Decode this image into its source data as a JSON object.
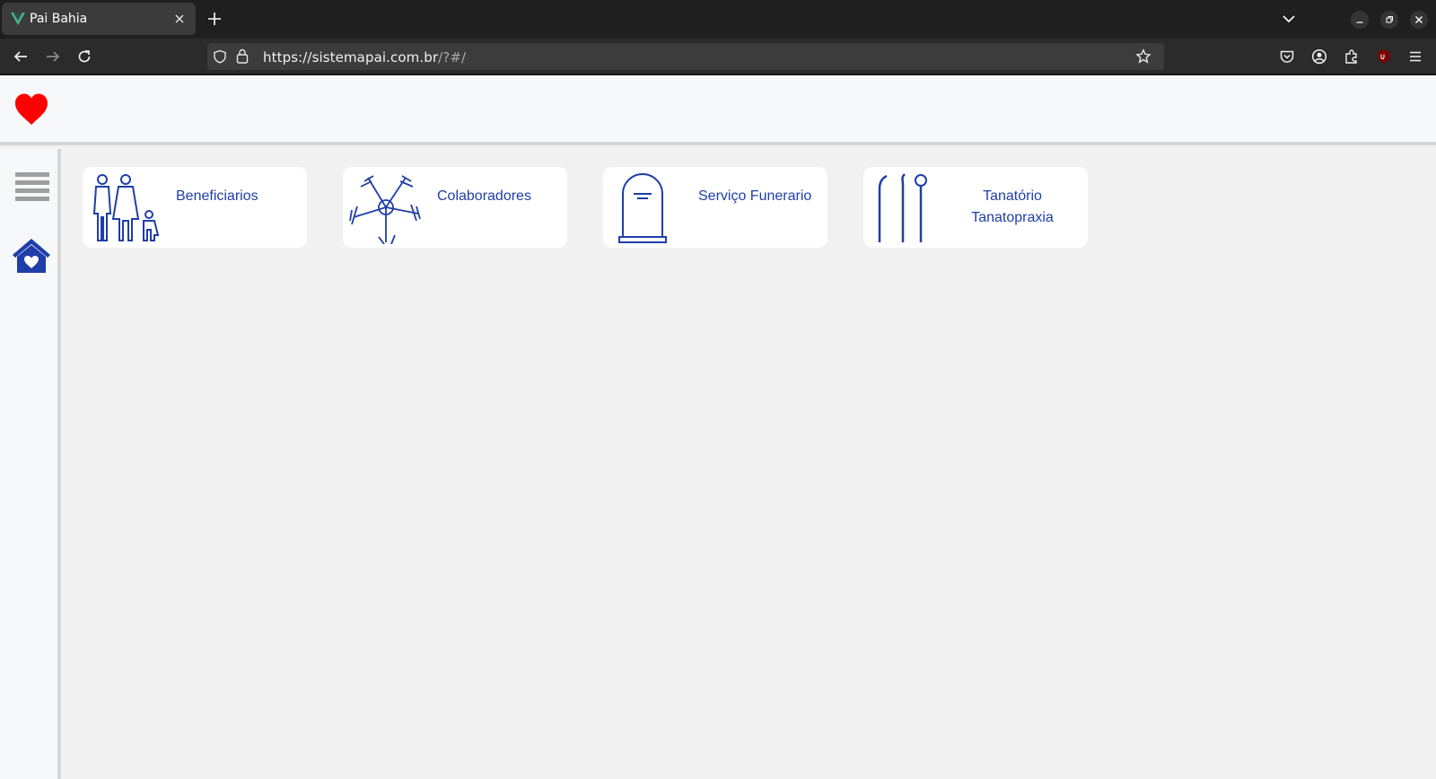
{
  "browser": {
    "tab_title": "Pai Bahia",
    "url_host": "https://sistemapai.com.br",
    "url_path": "/?#/"
  },
  "app": {
    "cards": [
      {
        "label": "Beneficiarios",
        "icon": "family-icon"
      },
      {
        "label": "Colaboradores",
        "icon": "hands-together-icon"
      },
      {
        "label": "Serviço Funerario",
        "icon": "tombstone-icon"
      },
      {
        "label_line1": "Tanatório",
        "label_line2": "Tanatopraxia",
        "icon": "embalming-tools-icon"
      }
    ],
    "colors": {
      "accent": "#1f3ea8",
      "heart": "#ff0000",
      "background": "#f1f1f1"
    }
  }
}
